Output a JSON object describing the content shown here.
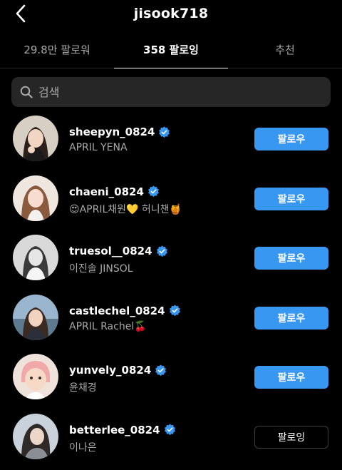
{
  "header": {
    "title": "jisook718"
  },
  "tabs": [
    {
      "label": "29.8만 팔로워",
      "active": false
    },
    {
      "label": "358 팔로잉",
      "active": true
    },
    {
      "label": "추천",
      "active": false
    }
  ],
  "search": {
    "placeholder": "검색"
  },
  "accounts": [
    {
      "username": "sheepyn_0824",
      "name": "APRIL YENA",
      "button": "팔로우",
      "verified": true
    },
    {
      "username": "chaeni_0824",
      "name": "😍APRIL채원💛 허니챈🍯",
      "button": "팔로우",
      "verified": true
    },
    {
      "username": "truesol__0824",
      "name": "이진솔 JINSOL",
      "button": "팔로우",
      "verified": true
    },
    {
      "username": "castlechel_0824",
      "name": "APRIL Rachel🍒",
      "button": "팔로우",
      "verified": true
    },
    {
      "username": "yunvely_0824",
      "name": "윤채경",
      "button": "팔로우",
      "verified": true
    },
    {
      "username": "betterlee_0824",
      "name": "이나은",
      "button": "팔로잉",
      "verified": true
    }
  ],
  "colors": {
    "accent": "#3897f0",
    "background": "#000000",
    "secondary_text": "#a8a8a8",
    "search_bg": "#262626"
  }
}
